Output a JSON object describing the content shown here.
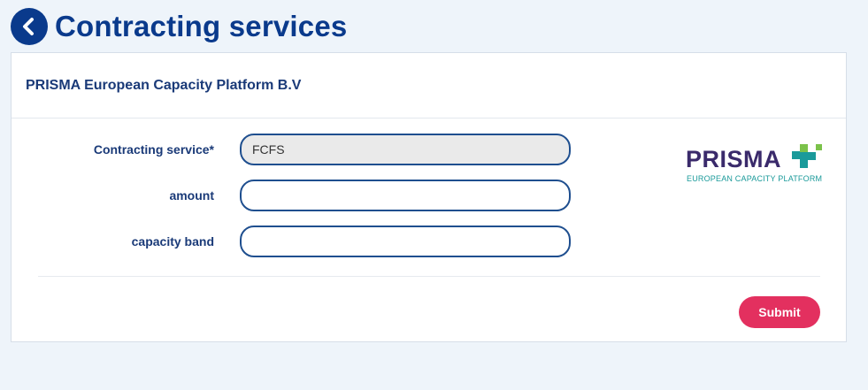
{
  "page": {
    "title": "Contracting services"
  },
  "card": {
    "provider_name": "PRISMA European Capacity Platform B.V"
  },
  "form": {
    "fields": [
      {
        "label": "Contracting service*",
        "value": "FCFS",
        "placeholder": ""
      },
      {
        "label": "amount",
        "value": "",
        "placeholder": ""
      },
      {
        "label": "capacity band",
        "value": "",
        "placeholder": ""
      }
    ],
    "submit_label": "Submit"
  },
  "logo": {
    "word": "PRISMA",
    "subtitle": "EUROPEAN CAPACITY PLATFORM"
  },
  "colors": {
    "brand_blue": "#0a3a8c",
    "submit_red": "#e3305f",
    "page_bg": "#eef4fa"
  }
}
